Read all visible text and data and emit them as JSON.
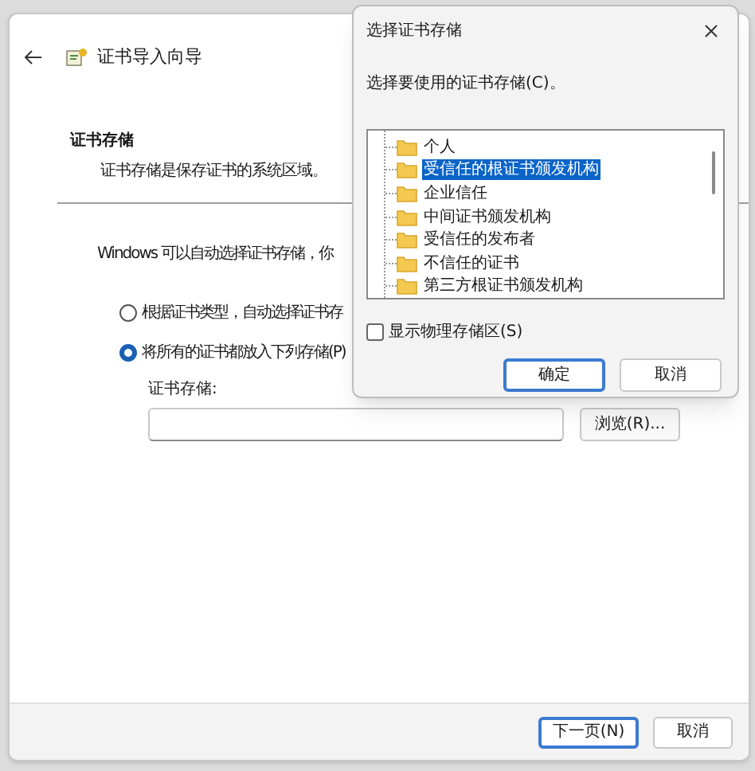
{
  "wizard": {
    "title": "证书导入向导",
    "heading": "证书存储",
    "description": "证书存储是保存证书的系统区域。",
    "intro": "Windows 可以自动选择证书存储，你",
    "options": [
      {
        "label": "根据证书类型，自动选择证书存",
        "selected": false
      },
      {
        "label": "将所有的证书都放入下列存储(P)",
        "selected": true
      }
    ],
    "store_label": "证书存储:",
    "browse_button": "浏览(R)...",
    "buttons": [
      {
        "label": "下一页(N)",
        "focused": true
      },
      {
        "label": "取消",
        "focused": false
      }
    ]
  },
  "dialog": {
    "title": "选择证书存储",
    "prompt": "选择要使用的证书存储(C)。",
    "stores": [
      {
        "label": "个人",
        "selected": false
      },
      {
        "label": "受信任的根证书颁发机构",
        "selected": true
      },
      {
        "label": "企业信任",
        "selected": false
      },
      {
        "label": "中间证书颁发机构",
        "selected": false
      },
      {
        "label": "受信任的发布者",
        "selected": false
      },
      {
        "label": "不信任的证书",
        "selected": false
      },
      {
        "label": "第三方根证书颁发机构",
        "selected": false
      }
    ],
    "show_physical": {
      "label": "显示物理存储区(S)",
      "checked": false
    },
    "buttons": [
      {
        "label": "确定",
        "focused": true
      },
      {
        "label": "取消",
        "focused": false
      }
    ]
  }
}
